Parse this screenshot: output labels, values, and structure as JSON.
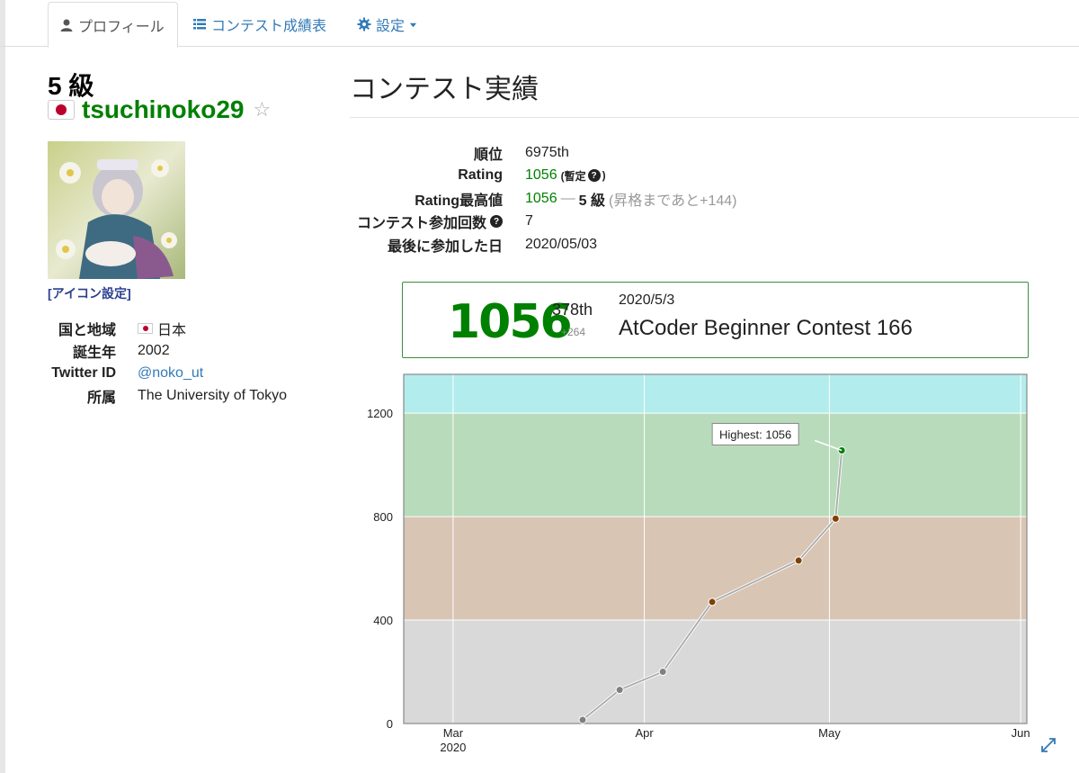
{
  "tabs": [
    {
      "label": "プロフィール",
      "icon": "user-icon",
      "active": true
    },
    {
      "label": "コンテスト成績表",
      "icon": "list-icon",
      "active": false
    },
    {
      "label": "設定",
      "icon": "gear-icon",
      "active": false
    }
  ],
  "profile": {
    "grade": "5 級",
    "username": "tsuchinoko29",
    "icon_setting": "[アイコン設定]",
    "info": [
      {
        "key": "国と地域",
        "value": "日本"
      },
      {
        "key": "誕生年",
        "value": "2002"
      },
      {
        "key": "Twitter ID",
        "value": "@noko_ut"
      },
      {
        "key": "所属",
        "value": "The University of Tokyo"
      }
    ]
  },
  "contest": {
    "heading": "コンテスト実績",
    "stats": {
      "rank_key": "順位",
      "rank_val": "6975th",
      "rating_key": "Rating",
      "rating_val": "1056",
      "rating_note": "(暫定",
      "highest_key": "Rating最高値",
      "highest_val": "1056",
      "highest_sep": "—",
      "highest_grade": "5 級",
      "highest_note": "(昇格まであと+144)",
      "count_key": "コンテスト参加回数",
      "count_val": "7",
      "last_key": "最後に参加した日",
      "last_val": "2020/05/03"
    },
    "summary": {
      "rating": "1056",
      "rank": "378th",
      "delta": "+264",
      "date": "2020/5/3",
      "contest_name": "AtCoder Beginner Contest 166"
    }
  },
  "colors": {
    "green": "#008000",
    "band_cyan": "#b3ecec",
    "band_green": "#b8dbbb",
    "band_brown": "#d9c5b4",
    "band_grey": "#d9d9d9"
  },
  "chart_data": {
    "type": "line",
    "ylim": [
      0,
      1350
    ],
    "yticks": [
      "0",
      "400",
      "800",
      "1200"
    ],
    "xticks": [
      {
        "label": "Mar",
        "date": "2020-03-01"
      },
      {
        "label": "Apr",
        "date": "2020-04-01"
      },
      {
        "label": "May",
        "date": "2020-05-01"
      },
      {
        "label": "Jun",
        "date": "2020-06-01"
      }
    ],
    "xtick_year": "2020",
    "xlim": [
      "2020-02-22",
      "2020-06-02"
    ],
    "bands": [
      {
        "from": 0,
        "to": 400,
        "color": "#d9d9d9"
      },
      {
        "from": 400,
        "to": 800,
        "color": "#d9c5b4"
      },
      {
        "from": 800,
        "to": 1200,
        "color": "#b8dbbb"
      },
      {
        "from": 1200,
        "to": 1350,
        "color": "#b3ecec"
      }
    ],
    "points": [
      {
        "date": "2020-03-22",
        "y": 14
      },
      {
        "date": "2020-03-28",
        "y": 130
      },
      {
        "date": "2020-04-04",
        "y": 200
      },
      {
        "date": "2020-04-12",
        "y": 470
      },
      {
        "date": "2020-04-26",
        "y": 630
      },
      {
        "date": "2020-05-02",
        "y": 792
      },
      {
        "date": "2020-05-03",
        "y": 1056
      }
    ],
    "annotation": "Highest: 1056"
  }
}
